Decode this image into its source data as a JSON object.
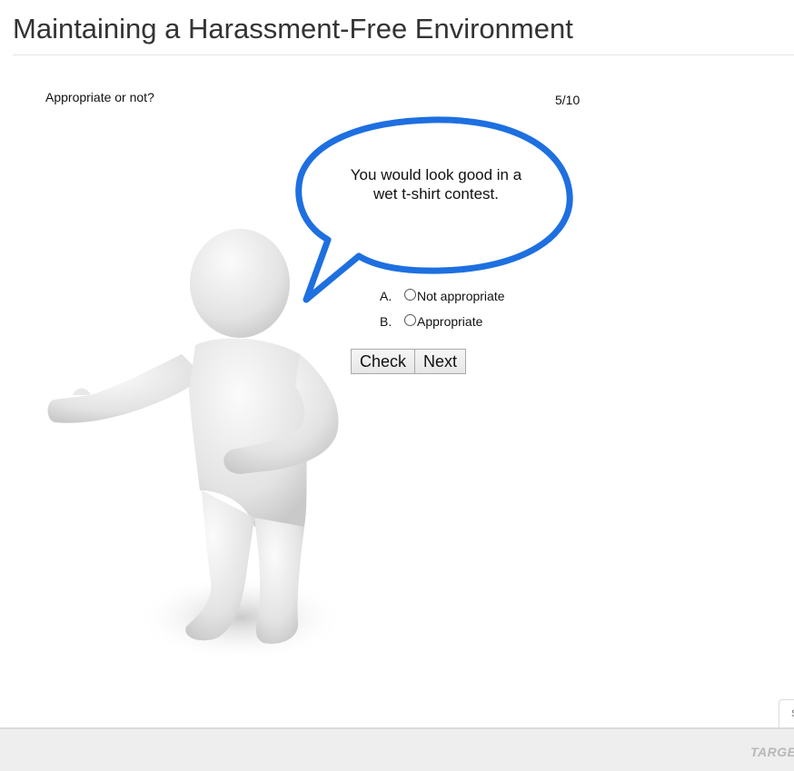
{
  "header": {
    "title": "Maintaining a Harassment-Free Environment"
  },
  "quiz": {
    "prompt": "Appropriate or not?",
    "progress": "5/10",
    "speech_line_1": "You would look good in a",
    "speech_line_2": "wet t-shirt contest.",
    "options": [
      {
        "letter": "A.",
        "label": "Not appropriate",
        "selected": false
      },
      {
        "letter": "B.",
        "label": "Appropriate",
        "selected": false
      }
    ],
    "check_label": "Check",
    "next_label": "Next"
  },
  "side_tab": {
    "label": "S"
  },
  "footer": {
    "logo_text": "TARGE"
  },
  "colors": {
    "bubble_outline": "#1e6fe0",
    "figure": "#e6e6e6",
    "footer_bg": "#eeeeee"
  }
}
